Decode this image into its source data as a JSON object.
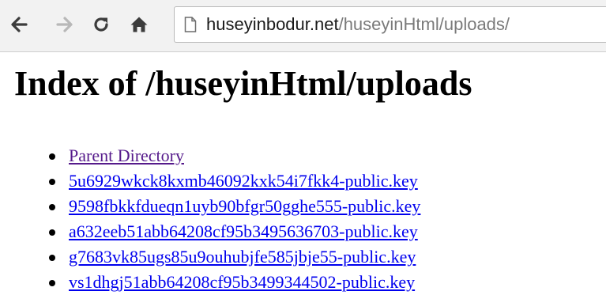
{
  "browser": {
    "url_host": "huseyinbodur.net",
    "url_path": "/huseyinHtml/uploads/",
    "icons": {
      "back": "arrow-left-icon",
      "forward": "arrow-right-icon",
      "reload": "reload-icon",
      "home": "home-icon",
      "page": "page-icon"
    }
  },
  "page": {
    "title": "Index of /huseyinHtml/uploads",
    "links": [
      {
        "label": "Parent Directory",
        "visited": true
      },
      {
        "label": "5u6929wkck8kxmb46092kxk54i7fkk4-public.key",
        "visited": false
      },
      {
        "label": "9598fbkkfdueqn1uyb90bfgr50gghe555-public.key",
        "visited": false
      },
      {
        "label": "a632eeb51abb64208cf95b3495636703-public.key",
        "visited": false
      },
      {
        "label": "g7683vk85ugs85u9ouhubjfe585jbje55-public.key",
        "visited": false
      },
      {
        "label": "vs1dhgj51abb64208cf95b3499344502-public.key",
        "visited": false
      }
    ]
  },
  "colors": {
    "link": "#0000ee",
    "visited_link": "#551a8b",
    "toolbar_bg": "#f2f2f2"
  }
}
